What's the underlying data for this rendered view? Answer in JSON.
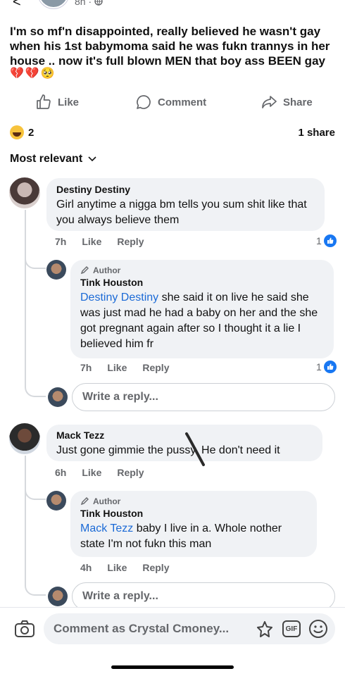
{
  "post": {
    "time": "8h ·",
    "text": "I'm so mf'n disappointed, really believed he wasn't gay when his 1st babymoma said he was fukn trannys in her house .. now it's full blown MEN that  boy ass BEEN gay",
    "emojis": "💔💔🥺"
  },
  "actions": {
    "like": "Like",
    "comment": "Comment",
    "share": "Share"
  },
  "stats": {
    "reaction_count": "2",
    "shares": "1 share"
  },
  "filter": {
    "label": "Most relevant"
  },
  "comments": [
    {
      "name": "Destiny Destiny",
      "text": "Girl anytime a nigga bm tells you sum shit like that you always believe them",
      "time": "7h",
      "like": "Like",
      "reply": "Reply",
      "likes": "1",
      "reply_item": {
        "badge": "Author",
        "name": "Tink Houston",
        "mention": "Destiny Destiny",
        "text": " she said it on live he said she was just mad he had a baby on her and the she got pregnant again after so I thought it a lie I believed him fr",
        "time": "7h",
        "like": "Like",
        "reply": "Reply",
        "likes": "1"
      },
      "reply_placeholder": "Write a reply..."
    },
    {
      "name": "Mack Tezz",
      "text": "Just gone gimmie the pussy. He don't need it",
      "time": "6h",
      "like": "Like",
      "reply": "Reply",
      "reply_item": {
        "badge": "Author",
        "name": "Tink Houston",
        "mention": "Mack Tezz",
        "text": " baby I live in a. Whole nother state I'm not fukn this man",
        "time": "4h",
        "like": "Like",
        "reply": "Reply"
      },
      "reply_placeholder": "Write a reply..."
    }
  ],
  "composer": {
    "placeholder": "Comment as Crystal Cmoney...",
    "gif": "GIF"
  },
  "colors": {
    "link": "#1b6ad6",
    "like_blue": "#1877f2",
    "bubble": "#f0f2f5",
    "muted": "#65676b"
  }
}
